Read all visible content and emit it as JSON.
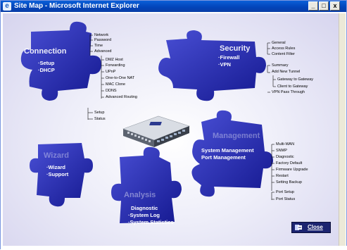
{
  "window": {
    "title": "Site Map - Microsoft Internet Explorer",
    "icon": "ie-icon",
    "controls": {
      "minimize": "_",
      "maximize": "□",
      "close": "x"
    }
  },
  "pieces": {
    "connection": {
      "title": "Connection",
      "links": [
        "Setup",
        "DHCP"
      ]
    },
    "security": {
      "title": "Security",
      "links": [
        "Firewall",
        "VPN"
      ]
    },
    "management": {
      "title": "Management",
      "links": [
        "System Management",
        "Port Management"
      ]
    },
    "wizard": {
      "title": "Wizard",
      "links": [
        "Wizard",
        "Support"
      ]
    },
    "analysis": {
      "title": "Analysis",
      "links": [
        "Diagnostic",
        "System Log",
        "System Statistics"
      ]
    }
  },
  "submenus": {
    "connection_setup": [
      "Network",
      "Password",
      "Time",
      "Advanced"
    ],
    "connection_advanced": [
      "DMZ Host",
      "Forwarding",
      "UPnP",
      "One-to-One NAT",
      "MAC Clone",
      "DDNS",
      "Advanced Routing"
    ],
    "connection_dhcp": [
      "Setup",
      "Status"
    ],
    "security_firewall": [
      "General",
      "Access Rules",
      "Content Filter"
    ],
    "security_vpn": [
      "Summary",
      "Add New Tunnel"
    ],
    "security_tunnel": [
      "Gateway to Gateway",
      "Client to Gateway"
    ],
    "security_passthrough": [
      "VPN Pass Through"
    ],
    "management_system": [
      "Multi-WAN",
      "SNMP",
      "Diagnostic",
      "Factory Default",
      "Firmware Upgrade",
      "Restart",
      "Setting Backup"
    ],
    "management_port": [
      "Port Setup",
      "Port Status"
    ]
  },
  "close_button": {
    "label": "Close",
    "icon": "close-door-icon"
  },
  "colors": {
    "piece": "#1b1fa6",
    "piece_light": "#3d43c9",
    "titlebar": "#0a4fc9"
  }
}
